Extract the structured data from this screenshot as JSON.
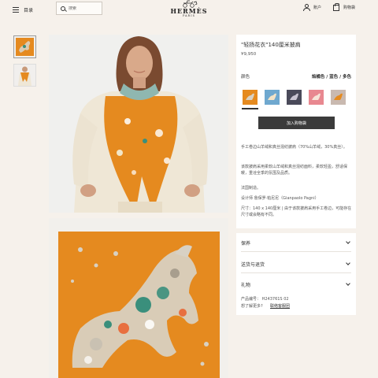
{
  "header": {
    "menu_label": "目录",
    "search_placeholder": "搜索",
    "brand_name": "HERMÈS",
    "brand_city": "PARIS",
    "account_label": "账户",
    "cart_label": "购物袋"
  },
  "product": {
    "title": "\"轻扬花衣\"140厘米披肩",
    "price": "¥9,950",
    "color_label": "颜色",
    "color_value": "焰橘色 / 蓝色 / 多色",
    "add_to_cart": "加入购物袋",
    "description": [
      "手工卷边山羊绒和真丝混纺披肩（70%山羊绒，30%真丝）。",
      "该款披肩采用柔软山羊绒和真丝混纺面料，柔软轻盈，舒适保暖，重诠全季的氛围及品质。",
      "法国制造。",
      "设计师 詹保罗·帕尼尼（Gianpaolo Pagni）",
      "尺寸：140 x 140厘米 | 由于该款披肩采用手工卷边，可能存在尺寸或会略有不同。"
    ],
    "swatches": [
      {
        "name": "焰橘色",
        "color": "#e58a1f",
        "selected": true
      },
      {
        "name": "蓝色",
        "color": "#6fa8cf",
        "selected": false
      },
      {
        "name": "黑色",
        "color": "#4a4a5a",
        "selected": false
      },
      {
        "name": "粉色",
        "color": "#e88890",
        "selected": false
      },
      {
        "name": "灰色",
        "color": "#c9b9b0",
        "selected": false
      }
    ]
  },
  "accordion": {
    "items": [
      {
        "label": "保养"
      },
      {
        "label": "送货与退货"
      },
      {
        "label": "礼物"
      }
    ],
    "ref_text": "产品编号：   H243761S 02",
    "help_text": "想了解更多?",
    "contact_link": "联络客服团"
  },
  "colors": {
    "background": "#f6f1eb",
    "accent_orange": "#e58a1f",
    "button_dark": "#3b3b3b"
  }
}
